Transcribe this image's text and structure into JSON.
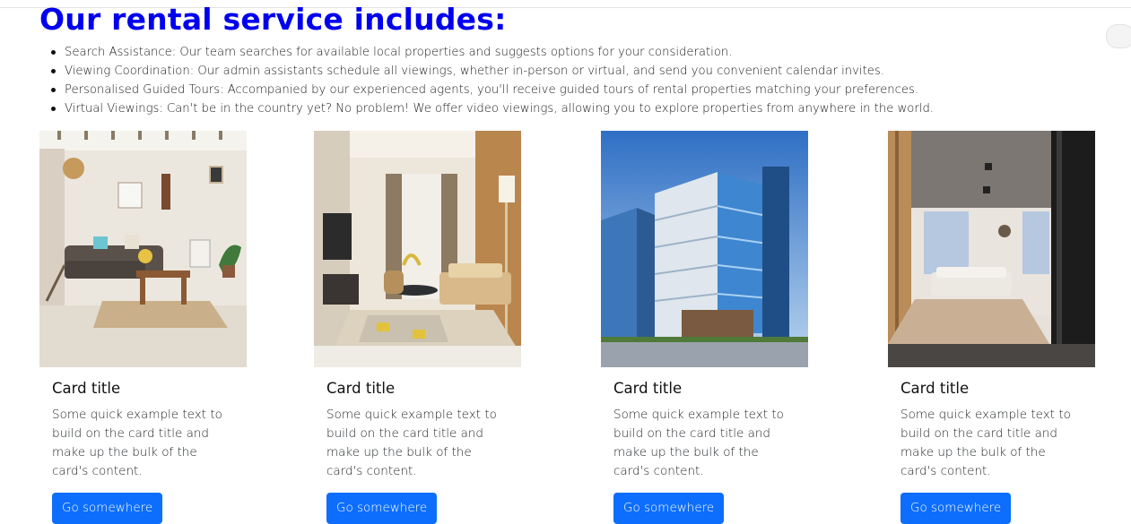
{
  "heading": "Our rental service includes:",
  "features": [
    "Search Assistance: Our team searches for available local properties and suggests options for your consideration.",
    "Viewing Coordination: Our admin assistants schedule all viewings, whether in-person or virtual, and send you convenient calendar invites.",
    "Personalised Guided Tours: Accompanied by our experienced agents, you'll receive guided tours of rental properties matching your preferences.",
    "Virtual Viewings: Can't be in the country yet? No problem! We offer video viewings, allowing you to explore properties from anywhere in the world."
  ],
  "cards": [
    {
      "image": "living-room-photo",
      "title": "Card title",
      "text": "Some quick example text to build on the card title and make up the bulk of the card's content.",
      "button": "Go somewhere"
    },
    {
      "image": "modern-lounge-photo",
      "title": "Card title",
      "text": "Some quick example text to build on the card title and make up the bulk of the card's content.",
      "button": "Go somewhere"
    },
    {
      "image": "office-building-photo",
      "title": "Card title",
      "text": "Some quick example text to build on the card title and make up the bulk of the card's content.",
      "button": "Go somewhere"
    },
    {
      "image": "apartment-interior-photo",
      "title": "Card title",
      "text": "Some quick example text to build on the card title and make up the bulk of the card's content.",
      "button": "Go somewhere"
    }
  ],
  "colors": {
    "heading": "#0000ee",
    "button": "#0d6efd",
    "button_text": "#ffffff"
  }
}
